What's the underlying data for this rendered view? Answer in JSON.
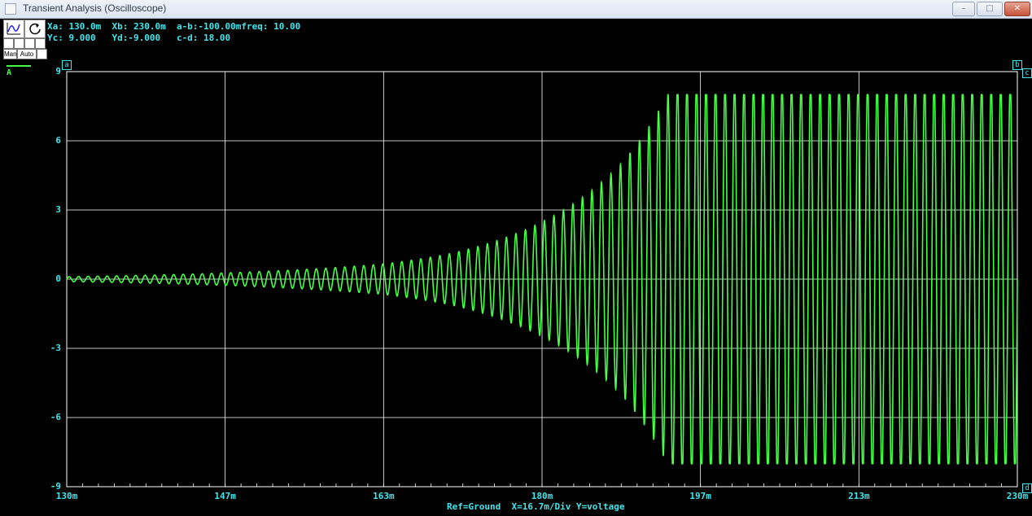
{
  "window": {
    "title": "Transient Analysis (Oscilloscope)",
    "minimize": "–",
    "maximize": "□",
    "close": "✕"
  },
  "toolbar": {
    "mode_manual": "Man",
    "mode_auto": "Auto",
    "icons": [
      "graph-icon",
      "reset-icon"
    ]
  },
  "readout": {
    "line1": "Xa: 130.0m  Xb: 230.0m  a-b:-100.00mfreq: 10.00",
    "line2": "Yc: 9.000   Yd:-9.000   c-d: 18.00"
  },
  "channel": {
    "label": "A",
    "color": "#45ff45"
  },
  "cursors": {
    "a": "a",
    "b": "b",
    "c": "c",
    "d": "d"
  },
  "footer": "Ref=Ground  X=16.7m/Div Y=voltage",
  "chart_data": {
    "type": "line",
    "title": "",
    "xlabel": "",
    "ylabel": "",
    "xlim": [
      0.13,
      0.23
    ],
    "ylim": [
      -9,
      9
    ],
    "x_tick_labels": [
      "130m",
      "147m",
      "163m",
      "180m",
      "197m",
      "213m",
      "230m"
    ],
    "y_tick_labels": [
      "9",
      "6",
      "3",
      "0",
      "-3",
      "-6",
      "-9"
    ],
    "grid": true,
    "series": [
      {
        "color": "#45ff45",
        "signal": "sine oscillation with growing envelope, clipped",
        "frequency_hz": 1000,
        "envelope": {
          "x": [
            0.13,
            0.15,
            0.163,
            0.17,
            0.18,
            0.188,
            0.194,
            0.23
          ],
          "amplitude": [
            0.1,
            0.3,
            0.6,
            1.0,
            2.3,
            4.5,
            8.0,
            8.0
          ]
        },
        "clip_level": 8.0
      }
    ]
  }
}
